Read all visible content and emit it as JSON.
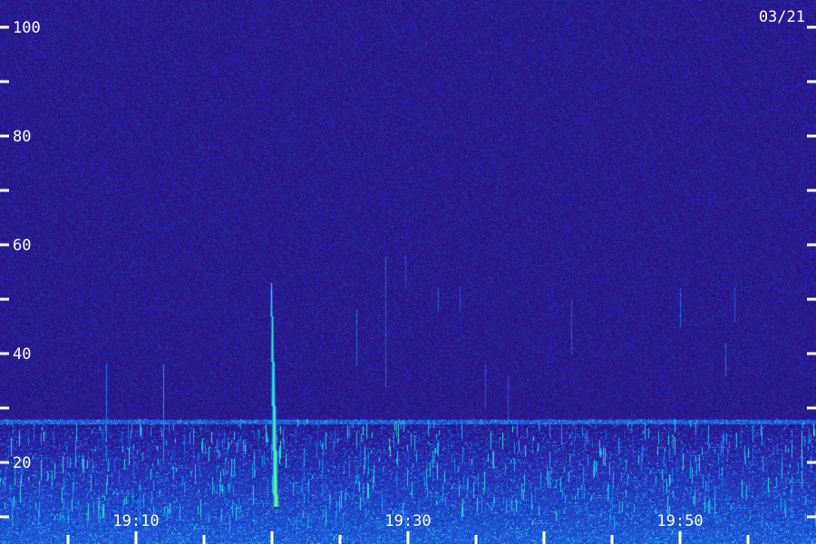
{
  "chart_data": {
    "type": "heatmap",
    "date_label": "03/21",
    "y_ticks": [
      {
        "value": 100,
        "label": "100"
      },
      {
        "value": 90,
        "label": ""
      },
      {
        "value": 80,
        "label": "80"
      },
      {
        "value": 70,
        "label": ""
      },
      {
        "value": 60,
        "label": "60"
      },
      {
        "value": 50,
        "label": ""
      },
      {
        "value": 40,
        "label": "40"
      },
      {
        "value": 30,
        "label": ""
      },
      {
        "value": 20,
        "label": "20"
      },
      {
        "value": 10,
        "label": ""
      }
    ],
    "x_ticks": [
      {
        "value": "19:10",
        "label": "19:10"
      },
      {
        "value": "19:20",
        "label": ""
      },
      {
        "value": "19:30",
        "label": "19:30"
      },
      {
        "value": "19:40",
        "label": ""
      },
      {
        "value": "19:50",
        "label": "19:50"
      }
    ],
    "x_range": [
      "19:05",
      "19:55"
    ],
    "y_range": [
      10,
      102
    ],
    "colormap": [
      "#2a0a56",
      "#2b1a9a",
      "#1e4fd6",
      "#1aa0ff",
      "#35e3c8",
      "#7dff5a"
    ],
    "features": {
      "background_level": 0.18,
      "noise_band": {
        "y_low": 10,
        "y_high": 28,
        "level": 0.55
      },
      "horizontal_line": {
        "y": 27.5,
        "level": 0.5
      },
      "strong_trace": {
        "x_start": "19:19:55",
        "x_end": "19:20:15",
        "y_low": 12,
        "y_high": 53,
        "level": 1.0
      },
      "faint_traces": [
        {
          "x": "19:07:50",
          "y_low": 24,
          "y_high": 38,
          "level": 0.45
        },
        {
          "x": "19:12:00",
          "y_low": 20,
          "y_high": 38,
          "level": 0.5
        },
        {
          "x": "19:26:10",
          "y_low": 38,
          "y_high": 48,
          "level": 0.4
        },
        {
          "x": "19:28:20",
          "y_low": 34,
          "y_high": 58,
          "level": 0.35
        },
        {
          "x": "19:29:50",
          "y_low": 52,
          "y_high": 58,
          "level": 0.3
        },
        {
          "x": "19:32:10",
          "y_low": 48,
          "y_high": 52,
          "level": 0.35
        },
        {
          "x": "19:33:50",
          "y_low": 48,
          "y_high": 52,
          "level": 0.35
        },
        {
          "x": "19:35:40",
          "y_low": 30,
          "y_high": 38,
          "level": 0.35
        },
        {
          "x": "19:37:20",
          "y_low": 28,
          "y_high": 36,
          "level": 0.35
        },
        {
          "x": "19:42:00",
          "y_low": 40,
          "y_high": 50,
          "level": 0.35
        },
        {
          "x": "19:50:00",
          "y_low": 45,
          "y_high": 52,
          "level": 0.4
        },
        {
          "x": "19:53:20",
          "y_low": 36,
          "y_high": 42,
          "level": 0.4
        },
        {
          "x": "19:54:00",
          "y_low": 46,
          "y_high": 52,
          "level": 0.35
        }
      ]
    }
  }
}
